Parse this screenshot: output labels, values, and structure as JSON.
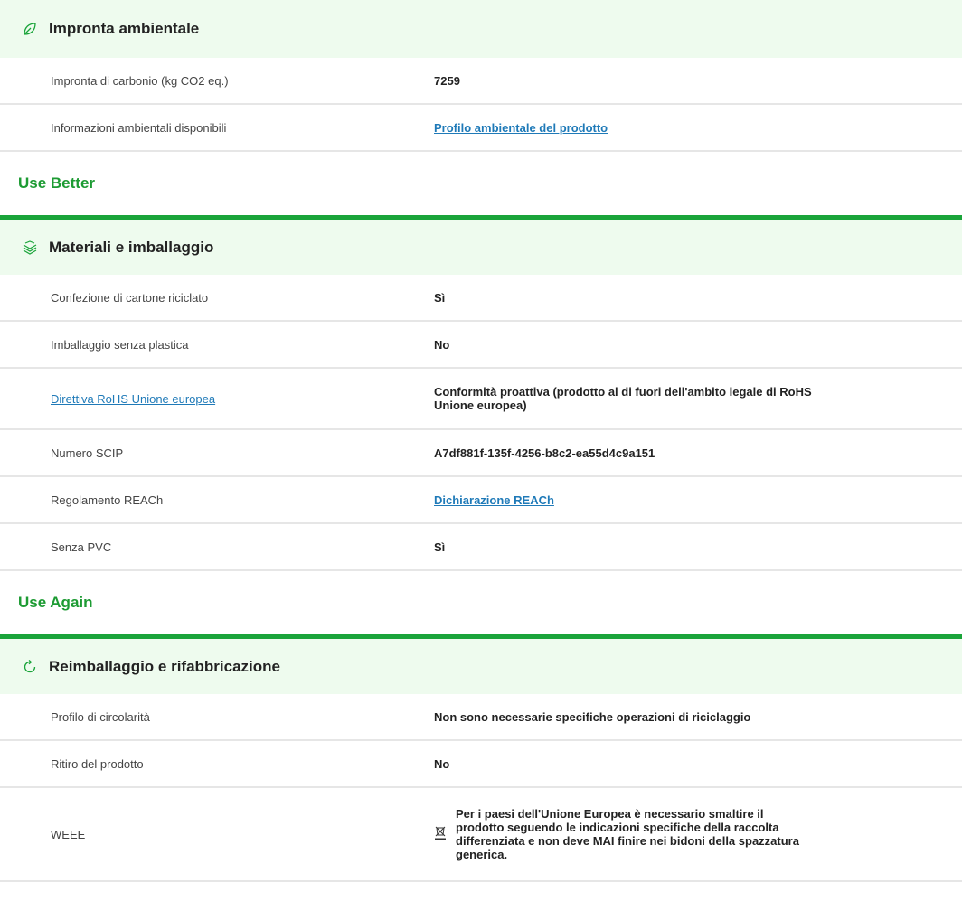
{
  "sections": [
    {
      "title": "",
      "category": {
        "icon": "leaf-icon",
        "title": "Impronta ambientale",
        "rows": [
          {
            "label": "Impronta di carbonio (kg CO2 eq.)",
            "value": "7259"
          },
          {
            "label": "Informazioni ambientali disponibili",
            "value": "Profilo ambientale del prodotto",
            "value_link": true
          }
        ]
      }
    },
    {
      "title": "Use Better",
      "category": {
        "icon": "layers-icon",
        "title": "Materiali e imballaggio",
        "rows": [
          {
            "label": "Confezione di cartone riciclato",
            "value": "Sì"
          },
          {
            "label": "Imballaggio senza plastica",
            "value": "No"
          },
          {
            "label": "Direttiva RoHS Unione europea",
            "label_link": true,
            "value": "Conformità proattiva (prodotto al di fuori dell'ambito legale di RoHS Unione europea)"
          },
          {
            "label": "Numero SCIP",
            "value": "A7df881f-135f-4256-b8c2-ea55d4c9a151"
          },
          {
            "label": "Regolamento REACh",
            "value": "Dichiarazione REACh",
            "value_link": true
          },
          {
            "label": "Senza PVC",
            "value": "Sì"
          }
        ]
      }
    },
    {
      "title": "Use Again",
      "category": {
        "icon": "refresh-icon",
        "title": "Reimballaggio e rifabbricazione",
        "rows": [
          {
            "label": "Profilo di circolarità",
            "value": "Non sono necessarie specifiche operazioni di riciclaggio"
          },
          {
            "label": "Ritiro del prodotto",
            "value": "No"
          },
          {
            "label": "WEEE",
            "value": "Per i paesi dell'Unione Europea è necessario smaltire il prodotto seguendo le indicazioni specifiche della raccolta differenziata e non deve MAI finire nei bidoni della spazzatura generica.",
            "value_icon": "crossed-bin-icon"
          }
        ]
      }
    }
  ],
  "colors": {
    "accent": "#1aa43a",
    "section_title": "#1d9b33",
    "header_bg": "#eefbee",
    "link": "#1f7ab8"
  }
}
